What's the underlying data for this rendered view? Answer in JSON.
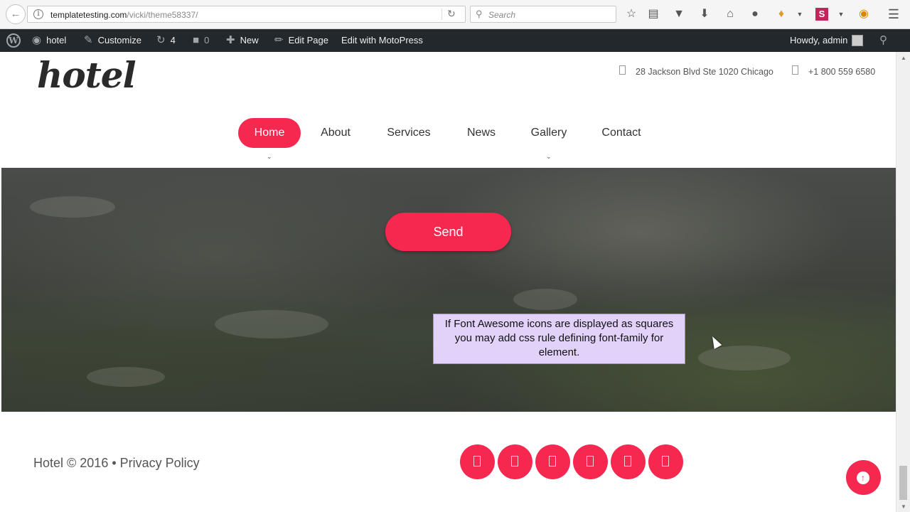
{
  "browser": {
    "url_host": "templatetesting.com",
    "url_path": "/vicki/theme58337/",
    "search_placeholder": "Search",
    "icons": [
      "back-arrow-icon",
      "info-icon",
      "reload-icon",
      "search-icon",
      "bookmark-star-icon",
      "reading-list-icon",
      "pocket-icon",
      "download-icon",
      "home-icon",
      "chat-icon",
      "extension-icon",
      "dropdown-icon",
      "s-extension-icon",
      "dropdown-icon",
      "firefox-icon",
      "menu-icon"
    ]
  },
  "admin_bar": {
    "site_name": "hotel",
    "customize": "Customize",
    "updates_count": "4",
    "comments_count": "0",
    "new_label": "New",
    "edit_page": "Edit Page",
    "edit_with": "Edit with MotoPress",
    "howdy": "Howdy, admin"
  },
  "header": {
    "logo": "hotel",
    "address": "28 Jackson Blvd Ste 1020 Chicago",
    "phone": "+1 800 559 6580"
  },
  "menu": [
    {
      "label": "Home",
      "active": true,
      "has_submenu": true
    },
    {
      "label": "About",
      "active": false,
      "has_submenu": false
    },
    {
      "label": "Services",
      "active": false,
      "has_submenu": false
    },
    {
      "label": "News",
      "active": false,
      "has_submenu": false
    },
    {
      "label": "Gallery",
      "active": false,
      "has_submenu": true
    },
    {
      "label": "Contact",
      "active": false,
      "has_submenu": false
    }
  ],
  "hero": {
    "send_label": "Send"
  },
  "tooltip": {
    "text": "If Font Awesome icons are displayed as squares you may add css rule defining font-family for element."
  },
  "footer": {
    "copyright": "Hotel © 2016 • Privacy Policy",
    "social_icons": [
      "social-icon-1",
      "social-icon-2",
      "social-icon-3",
      "social-icon-4",
      "social-icon-5",
      "social-icon-6"
    ]
  },
  "colors": {
    "accent": "#f62850",
    "admin_bar": "#23282d",
    "tooltip_bg": "#e2d2fa"
  }
}
